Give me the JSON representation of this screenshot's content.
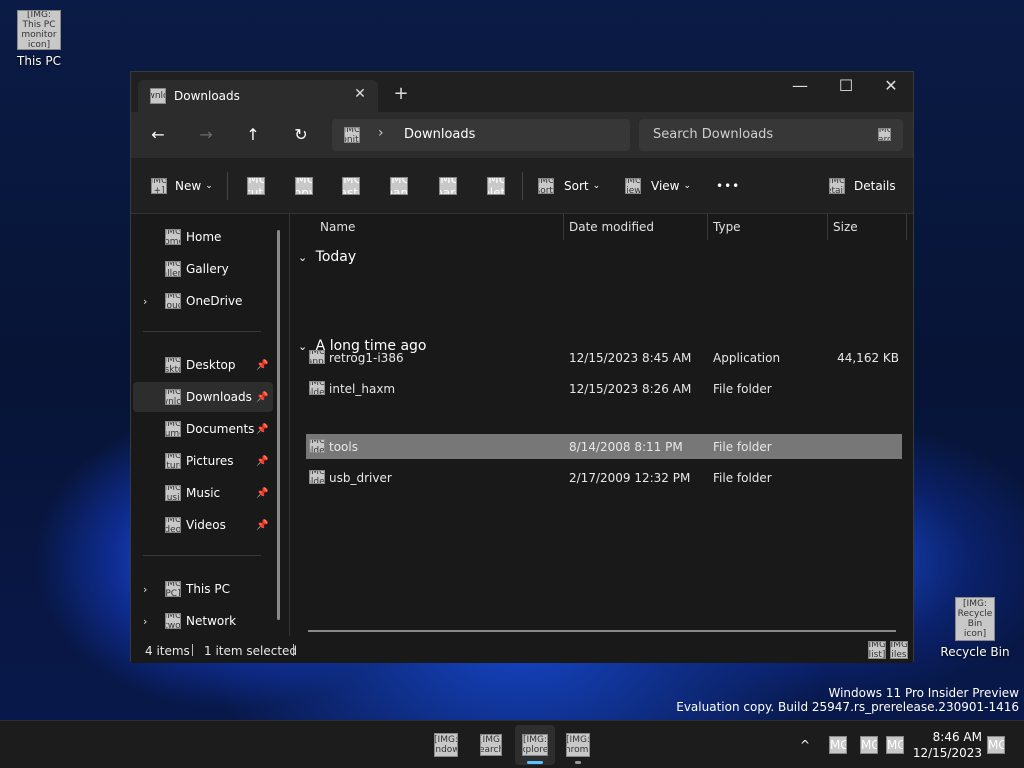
{
  "desktop": {
    "this_pc_label": "This PC",
    "recycle_bin_label": "Recycle Bin",
    "watermark_line1": "Windows 11 Pro Insider Preview",
    "watermark_line2": "Evaluation copy. Build 25947.rs_prerelease.230901-1416"
  },
  "explorer": {
    "tab_title": "Downloads",
    "tab_close_icon": "✕",
    "new_tab_icon": "+",
    "window_controls": {
      "minimize": "—",
      "maximize": "☐",
      "close": "✕"
    },
    "nav": {
      "back": "←",
      "forward": "→",
      "up": "↑",
      "refresh": "↻"
    },
    "breadcrumb": {
      "separator": "›",
      "current": "Downloads"
    },
    "search_placeholder": "Search Downloads",
    "toolbar": {
      "new_label": "New",
      "sort_label": "Sort",
      "view_label": "View",
      "more_label": "•••",
      "details_label": "Details",
      "dropdown_chevron": "⌄"
    },
    "sidebar": {
      "home": "Home",
      "gallery": "Gallery",
      "onedrive": "OneDrive",
      "desktop": "Desktop",
      "downloads": "Downloads",
      "documents": "Documents",
      "pictures": "Pictures",
      "music": "Music",
      "videos": "Videos",
      "this_pc": "This PC",
      "network": "Network",
      "expander": "›",
      "pin": "📌"
    },
    "columns": {
      "name": "Name",
      "date_modified": "Date modified",
      "type": "Type",
      "size": "Size"
    },
    "groups": {
      "today": {
        "label": "Today",
        "toggle": "⌄"
      },
      "long_ago": {
        "label": "A long time ago",
        "toggle": "⌄"
      }
    },
    "files": {
      "retrog": {
        "name": "retrog1-i386",
        "date": "12/15/2023 8:45 AM",
        "type": "Application",
        "size": "44,162 KB"
      },
      "intel_haxm": {
        "name": "intel_haxm",
        "date": "12/15/2023 8:26 AM",
        "type": "File folder",
        "size": ""
      },
      "tools": {
        "name": "tools",
        "date": "8/14/2008 8:11 PM",
        "type": "File folder",
        "size": ""
      },
      "usb_driver": {
        "name": "usb_driver",
        "date": "2/17/2009 12:32 PM",
        "type": "File folder",
        "size": ""
      }
    },
    "status": {
      "items": "4 items",
      "selected": "1 item selected"
    }
  },
  "taskbar": {
    "time": "8:46 AM",
    "date": "12/15/2023",
    "tray_chevron": "^"
  },
  "colors": {
    "accent": "#5ec1ff",
    "selection": "#777777",
    "window_bg": "#191919"
  }
}
